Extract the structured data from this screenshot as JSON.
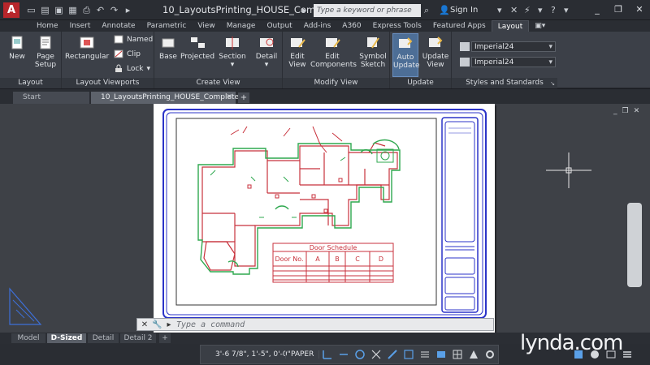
{
  "app": {
    "logo_letter": "A",
    "doc_title": "10_LayoutsPrinting_HOUSE_Comp...",
    "search_placeholder": "Type a keyword or phrase",
    "signin": "Sign In"
  },
  "ribbon_tabs": [
    "Home",
    "Insert",
    "Annotate",
    "Parametric",
    "View",
    "Manage",
    "Output",
    "Add-ins",
    "A360",
    "Express Tools",
    "Featured Apps",
    "Layout"
  ],
  "active_ribbon_tab": "Layout",
  "panels": {
    "layout": {
      "title": "Layout",
      "new": "New",
      "page_setup_1": "Page",
      "page_setup_2": "Setup"
    },
    "viewports": {
      "title": "Layout Viewports",
      "rectangular": "Rectangular",
      "named": "Named",
      "clip": "Clip",
      "lock": "Lock"
    },
    "create_view": {
      "title": "Create View",
      "base": "Base",
      "projected": "Projected",
      "section": "Section",
      "detail": "Detail"
    },
    "modify_view": {
      "title": "Modify View",
      "edit_view_1": "Edit",
      "edit_view_2": "View",
      "edit_comp_1": "Edit",
      "edit_comp_2": "Components",
      "symbol_1": "Symbol",
      "symbol_2": "Sketch"
    },
    "update": {
      "title": "Update",
      "auto_1": "Auto",
      "auto_2": "Update",
      "update_view_1": "Update",
      "update_view_2": "View"
    },
    "styles": {
      "title": "Styles and Standards",
      "style_1": "Imperial24",
      "style_2": "Imperial24"
    }
  },
  "file_tabs": [
    {
      "label": "Start",
      "active": false
    },
    {
      "label": "10_LayoutsPrinting_HOUSE_Complete",
      "active": true
    }
  ],
  "door_schedule": {
    "title": "Door Schedule",
    "headers": [
      "Door No.",
      "A",
      "B",
      "C",
      "D"
    ]
  },
  "command_line": {
    "placeholder": "Type a command"
  },
  "layout_tabs": [
    {
      "label": "Model",
      "active": false
    },
    {
      "label": "D-Sized",
      "active": true
    },
    {
      "label": "Detail",
      "active": false
    },
    {
      "label": "Detail 2",
      "active": false
    }
  ],
  "status": {
    "coords": "3'-6 7/8\", 1'-5\", 0'-0\"",
    "space": "PAPER"
  },
  "watermark": "lynda.com",
  "colors": {
    "floorplan_red": "#c8323c",
    "floorplan_green": "#2fa84f",
    "border_blue": "#2b33c8",
    "accent": "#4d6e96"
  }
}
